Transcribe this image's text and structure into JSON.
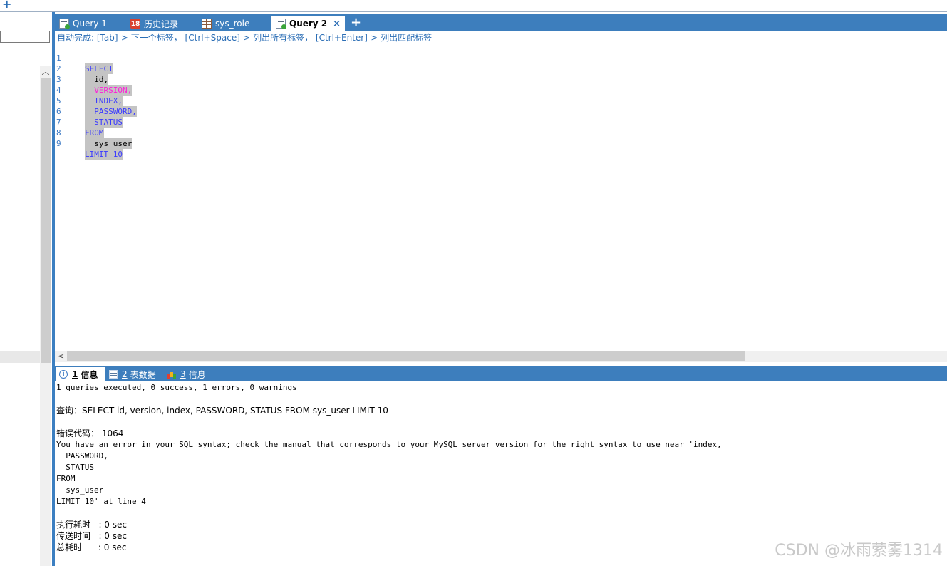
{
  "app": {
    "new_tab_symbol": "+"
  },
  "tabs": [
    {
      "label": "Query 1",
      "icon": "query-icon"
    },
    {
      "label": "历史记录",
      "icon": "history-icon",
      "badge": "18"
    },
    {
      "label": "sys_role",
      "icon": "table-icon"
    },
    {
      "label": "Query 2",
      "icon": "query-icon",
      "active": true,
      "close": "×"
    }
  ],
  "tab_add": "+",
  "editor": {
    "hint": "自动完成: [Tab]-> 下一个标签， [Ctrl+Space]-> 列出所有标签， [Ctrl+Enter]-> 列出匹配标签",
    "lines": [
      {
        "num": "1",
        "text": "SELECT"
      },
      {
        "num": "2",
        "text": "  id,"
      },
      {
        "num": "3",
        "text": "  VERSION,"
      },
      {
        "num": "4",
        "text": "  INDEX,"
      },
      {
        "num": "5",
        "text": "  PASSWORD,"
      },
      {
        "num": "6",
        "text": "  STATUS"
      },
      {
        "num": "7",
        "text": "FROM"
      },
      {
        "num": "8",
        "text": "  sys_user"
      },
      {
        "num": "9",
        "text": "LIMIT 10"
      }
    ]
  },
  "result_tabs": [
    {
      "num": "1",
      "label": "信息",
      "icon": "info-icon",
      "active": true
    },
    {
      "num": "2",
      "label": "表数据",
      "icon": "grid-icon"
    },
    {
      "num": "3",
      "label": "信息",
      "icon": "chart-icon"
    }
  ],
  "messages": {
    "summary": "1 queries executed, 0 success, 1 errors, 0 warnings",
    "query_line": "查询：SELECT id, version, index, PASSWORD, STATUS FROM sys_user LIMIT 10",
    "error_code_line": "错误代码： 1064",
    "error_lines": [
      "You have an error in your SQL syntax; check the manual that corresponds to your MySQL server version for the right syntax to use near 'index,",
      "  PASSWORD,",
      "  STATUS",
      "FROM",
      "  sys_user",
      "LIMIT 10' at line 4"
    ],
    "exec_time": "执行耗时   : 0 sec",
    "transfer_time": "传送时间   : 0 sec",
    "total_time": "总耗时      : 0 sec"
  },
  "watermark": "CSDN @冰雨萦雾1314"
}
